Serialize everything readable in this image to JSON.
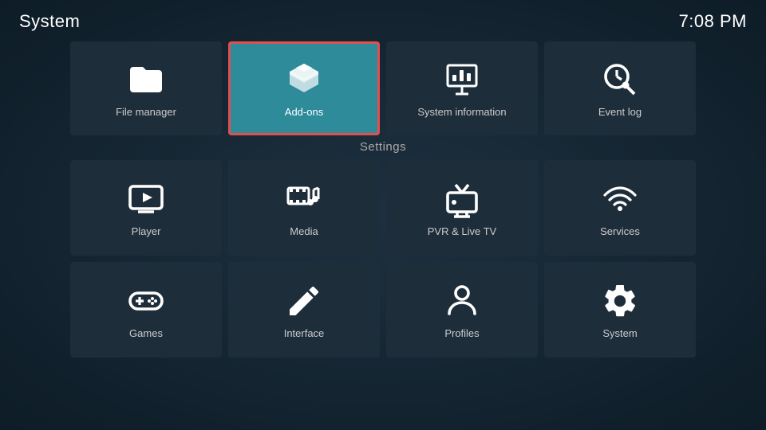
{
  "header": {
    "title": "System",
    "time": "7:08 PM"
  },
  "settings_label": "Settings",
  "top_row": [
    {
      "id": "file-manager",
      "label": "File manager",
      "icon": "folder"
    },
    {
      "id": "add-ons",
      "label": "Add-ons",
      "icon": "addons",
      "focused": true
    },
    {
      "id": "system-information",
      "label": "System information",
      "icon": "sysinfo"
    },
    {
      "id": "event-log",
      "label": "Event log",
      "icon": "eventlog"
    }
  ],
  "settings_row1": [
    {
      "id": "player",
      "label": "Player",
      "icon": "player"
    },
    {
      "id": "media",
      "label": "Media",
      "icon": "media"
    },
    {
      "id": "pvr-live-tv",
      "label": "PVR & Live TV",
      "icon": "pvr"
    },
    {
      "id": "services",
      "label": "Services",
      "icon": "services"
    }
  ],
  "settings_row2": [
    {
      "id": "games",
      "label": "Games",
      "icon": "games"
    },
    {
      "id": "interface",
      "label": "Interface",
      "icon": "interface"
    },
    {
      "id": "profiles",
      "label": "Profiles",
      "icon": "profiles"
    },
    {
      "id": "system",
      "label": "System",
      "icon": "system"
    }
  ]
}
